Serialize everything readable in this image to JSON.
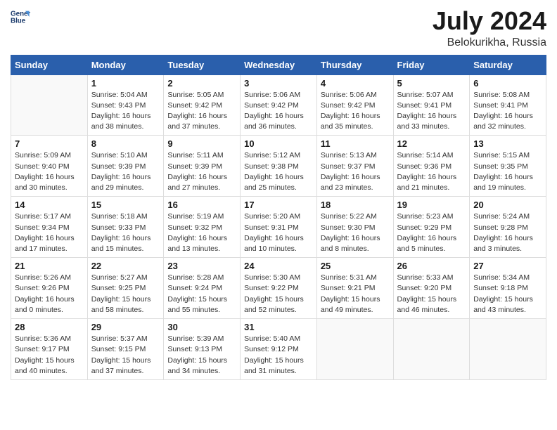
{
  "header": {
    "logo_line1": "General",
    "logo_line2": "Blue",
    "title": "July 2024",
    "location": "Belokurikha, Russia"
  },
  "weekdays": [
    "Sunday",
    "Monday",
    "Tuesday",
    "Wednesday",
    "Thursday",
    "Friday",
    "Saturday"
  ],
  "weeks": [
    [
      {
        "day": "",
        "sunrise": "",
        "sunset": "",
        "daylight": ""
      },
      {
        "day": "1",
        "sunrise": "Sunrise: 5:04 AM",
        "sunset": "Sunset: 9:43 PM",
        "daylight": "Daylight: 16 hours and 38 minutes."
      },
      {
        "day": "2",
        "sunrise": "Sunrise: 5:05 AM",
        "sunset": "Sunset: 9:42 PM",
        "daylight": "Daylight: 16 hours and 37 minutes."
      },
      {
        "day": "3",
        "sunrise": "Sunrise: 5:06 AM",
        "sunset": "Sunset: 9:42 PM",
        "daylight": "Daylight: 16 hours and 36 minutes."
      },
      {
        "day": "4",
        "sunrise": "Sunrise: 5:06 AM",
        "sunset": "Sunset: 9:42 PM",
        "daylight": "Daylight: 16 hours and 35 minutes."
      },
      {
        "day": "5",
        "sunrise": "Sunrise: 5:07 AM",
        "sunset": "Sunset: 9:41 PM",
        "daylight": "Daylight: 16 hours and 33 minutes."
      },
      {
        "day": "6",
        "sunrise": "Sunrise: 5:08 AM",
        "sunset": "Sunset: 9:41 PM",
        "daylight": "Daylight: 16 hours and 32 minutes."
      }
    ],
    [
      {
        "day": "7",
        "sunrise": "Sunrise: 5:09 AM",
        "sunset": "Sunset: 9:40 PM",
        "daylight": "Daylight: 16 hours and 30 minutes."
      },
      {
        "day": "8",
        "sunrise": "Sunrise: 5:10 AM",
        "sunset": "Sunset: 9:39 PM",
        "daylight": "Daylight: 16 hours and 29 minutes."
      },
      {
        "day": "9",
        "sunrise": "Sunrise: 5:11 AM",
        "sunset": "Sunset: 9:39 PM",
        "daylight": "Daylight: 16 hours and 27 minutes."
      },
      {
        "day": "10",
        "sunrise": "Sunrise: 5:12 AM",
        "sunset": "Sunset: 9:38 PM",
        "daylight": "Daylight: 16 hours and 25 minutes."
      },
      {
        "day": "11",
        "sunrise": "Sunrise: 5:13 AM",
        "sunset": "Sunset: 9:37 PM",
        "daylight": "Daylight: 16 hours and 23 minutes."
      },
      {
        "day": "12",
        "sunrise": "Sunrise: 5:14 AM",
        "sunset": "Sunset: 9:36 PM",
        "daylight": "Daylight: 16 hours and 21 minutes."
      },
      {
        "day": "13",
        "sunrise": "Sunrise: 5:15 AM",
        "sunset": "Sunset: 9:35 PM",
        "daylight": "Daylight: 16 hours and 19 minutes."
      }
    ],
    [
      {
        "day": "14",
        "sunrise": "Sunrise: 5:17 AM",
        "sunset": "Sunset: 9:34 PM",
        "daylight": "Daylight: 16 hours and 17 minutes."
      },
      {
        "day": "15",
        "sunrise": "Sunrise: 5:18 AM",
        "sunset": "Sunset: 9:33 PM",
        "daylight": "Daylight: 16 hours and 15 minutes."
      },
      {
        "day": "16",
        "sunrise": "Sunrise: 5:19 AM",
        "sunset": "Sunset: 9:32 PM",
        "daylight": "Daylight: 16 hours and 13 minutes."
      },
      {
        "day": "17",
        "sunrise": "Sunrise: 5:20 AM",
        "sunset": "Sunset: 9:31 PM",
        "daylight": "Daylight: 16 hours and 10 minutes."
      },
      {
        "day": "18",
        "sunrise": "Sunrise: 5:22 AM",
        "sunset": "Sunset: 9:30 PM",
        "daylight": "Daylight: 16 hours and 8 minutes."
      },
      {
        "day": "19",
        "sunrise": "Sunrise: 5:23 AM",
        "sunset": "Sunset: 9:29 PM",
        "daylight": "Daylight: 16 hours and 5 minutes."
      },
      {
        "day": "20",
        "sunrise": "Sunrise: 5:24 AM",
        "sunset": "Sunset: 9:28 PM",
        "daylight": "Daylight: 16 hours and 3 minutes."
      }
    ],
    [
      {
        "day": "21",
        "sunrise": "Sunrise: 5:26 AM",
        "sunset": "Sunset: 9:26 PM",
        "daylight": "Daylight: 16 hours and 0 minutes."
      },
      {
        "day": "22",
        "sunrise": "Sunrise: 5:27 AM",
        "sunset": "Sunset: 9:25 PM",
        "daylight": "Daylight: 15 hours and 58 minutes."
      },
      {
        "day": "23",
        "sunrise": "Sunrise: 5:28 AM",
        "sunset": "Sunset: 9:24 PM",
        "daylight": "Daylight: 15 hours and 55 minutes."
      },
      {
        "day": "24",
        "sunrise": "Sunrise: 5:30 AM",
        "sunset": "Sunset: 9:22 PM",
        "daylight": "Daylight: 15 hours and 52 minutes."
      },
      {
        "day": "25",
        "sunrise": "Sunrise: 5:31 AM",
        "sunset": "Sunset: 9:21 PM",
        "daylight": "Daylight: 15 hours and 49 minutes."
      },
      {
        "day": "26",
        "sunrise": "Sunrise: 5:33 AM",
        "sunset": "Sunset: 9:20 PM",
        "daylight": "Daylight: 15 hours and 46 minutes."
      },
      {
        "day": "27",
        "sunrise": "Sunrise: 5:34 AM",
        "sunset": "Sunset: 9:18 PM",
        "daylight": "Daylight: 15 hours and 43 minutes."
      }
    ],
    [
      {
        "day": "28",
        "sunrise": "Sunrise: 5:36 AM",
        "sunset": "Sunset: 9:17 PM",
        "daylight": "Daylight: 15 hours and 40 minutes."
      },
      {
        "day": "29",
        "sunrise": "Sunrise: 5:37 AM",
        "sunset": "Sunset: 9:15 PM",
        "daylight": "Daylight: 15 hours and 37 minutes."
      },
      {
        "day": "30",
        "sunrise": "Sunrise: 5:39 AM",
        "sunset": "Sunset: 9:13 PM",
        "daylight": "Daylight: 15 hours and 34 minutes."
      },
      {
        "day": "31",
        "sunrise": "Sunrise: 5:40 AM",
        "sunset": "Sunset: 9:12 PM",
        "daylight": "Daylight: 15 hours and 31 minutes."
      },
      {
        "day": "",
        "sunrise": "",
        "sunset": "",
        "daylight": ""
      },
      {
        "day": "",
        "sunrise": "",
        "sunset": "",
        "daylight": ""
      },
      {
        "day": "",
        "sunrise": "",
        "sunset": "",
        "daylight": ""
      }
    ]
  ]
}
